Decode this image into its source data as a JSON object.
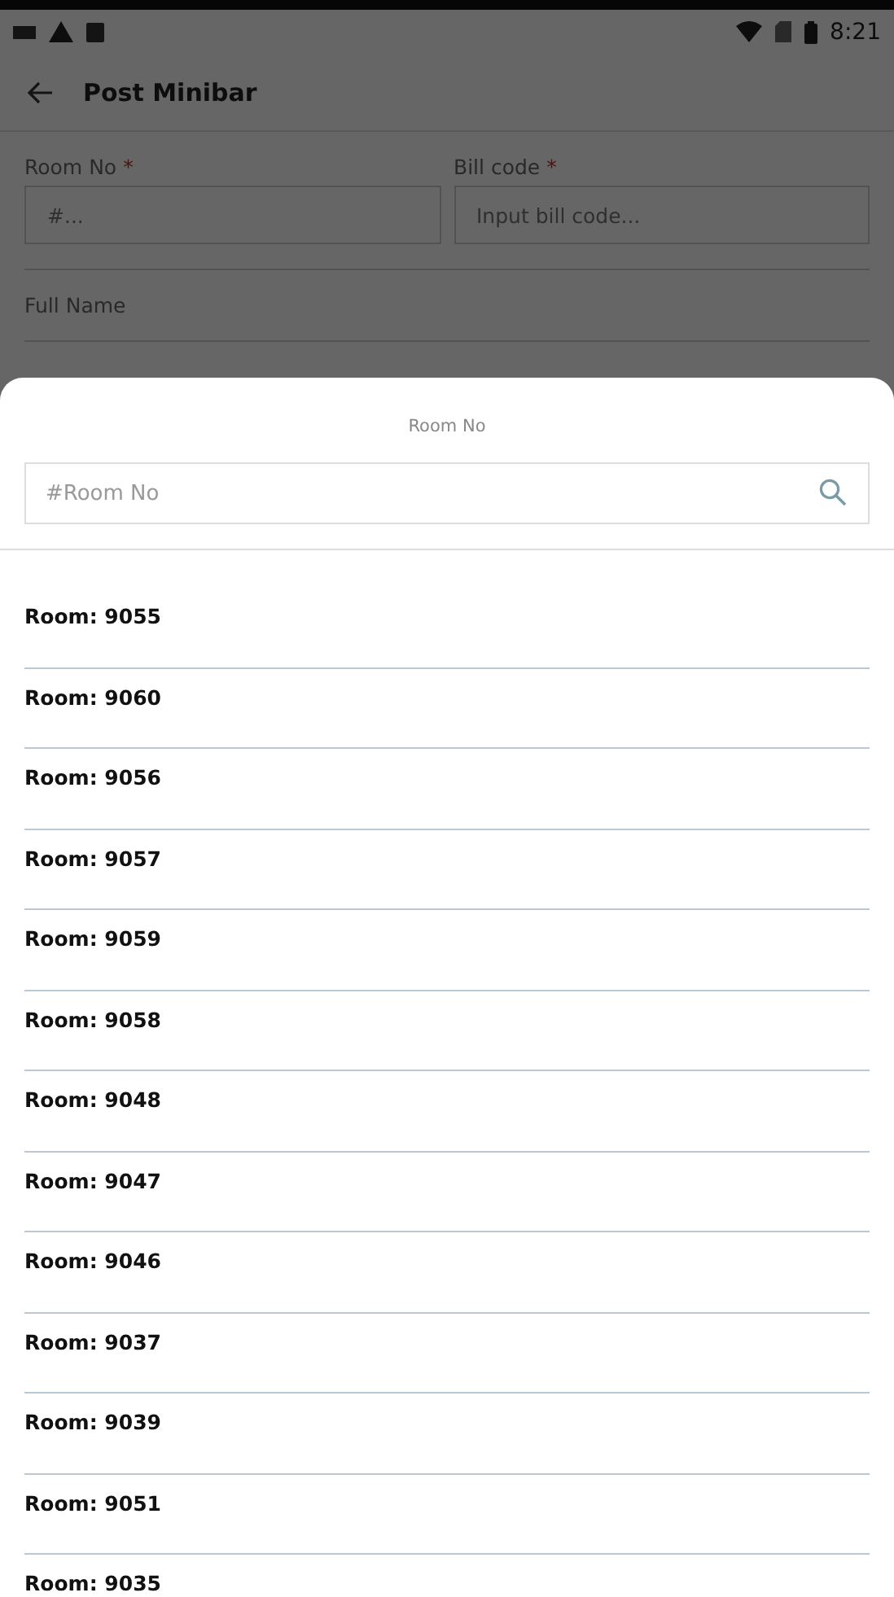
{
  "status_bar": {
    "time": "8:21"
  },
  "app_bar": {
    "title": "Post Minibar"
  },
  "form": {
    "fields": [
      {
        "label": "Room No",
        "required_mark": "*",
        "placeholder": "#..."
      },
      {
        "label": "Bill code",
        "required_mark": "*",
        "placeholder": "Input bill code..."
      }
    ],
    "full_name_label": "Full Name"
  },
  "sheet": {
    "title": "Room No",
    "search": {
      "placeholder": "#Room No"
    },
    "rooms": [
      "Room: 9055",
      "Room: 9060",
      "Room: 9056",
      "Room: 9057",
      "Room: 9059",
      "Room: 9058",
      "Room: 9048",
      "Room: 9047",
      "Room: 9046",
      "Room: 9037",
      "Room: 9039",
      "Room: 9051",
      "Room: 9035"
    ]
  }
}
